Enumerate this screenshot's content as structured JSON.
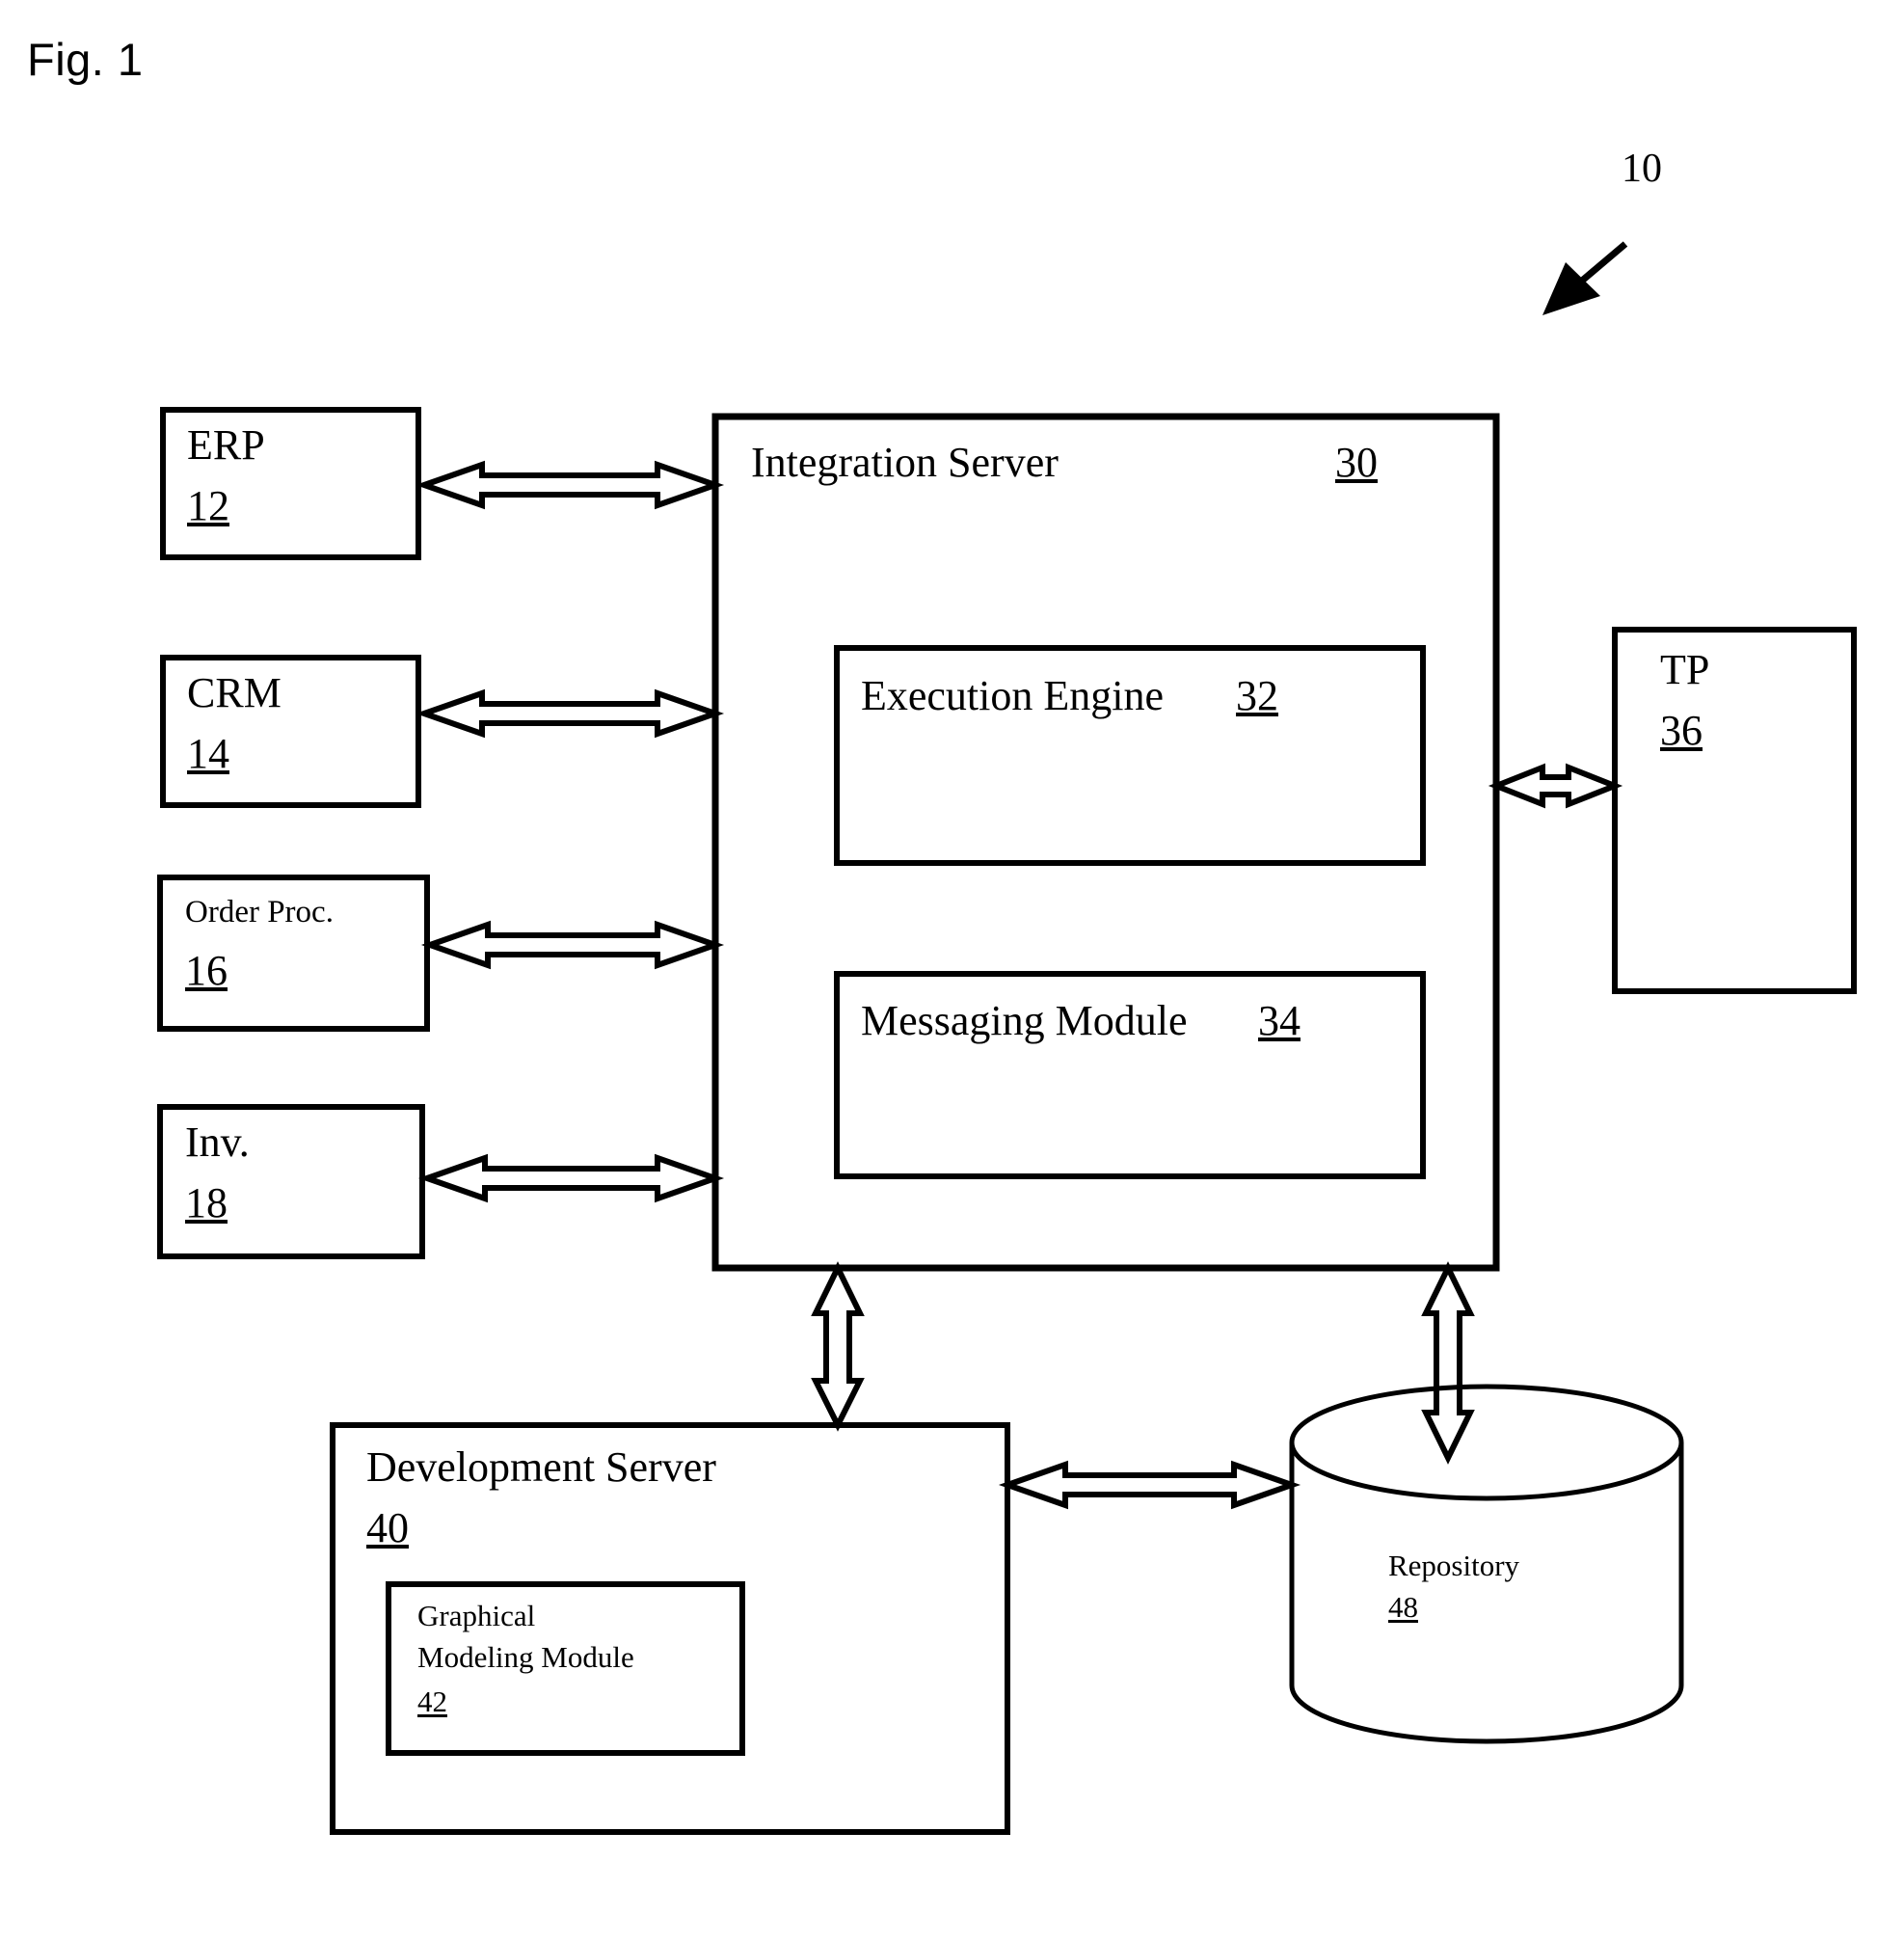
{
  "figure": {
    "label": "Fig. 1",
    "system_ref": "10"
  },
  "nodes": {
    "erp": {
      "title": "ERP",
      "ref": "12"
    },
    "crm": {
      "title": "CRM",
      "ref": "14"
    },
    "order_proc": {
      "title": "Order Proc.",
      "ref": "16"
    },
    "inv": {
      "title": "Inv.",
      "ref": "18"
    },
    "integration_server": {
      "title": "Integration Server",
      "ref": "30"
    },
    "execution_engine": {
      "title": "Execution Engine",
      "ref": "32"
    },
    "messaging_module": {
      "title": "Messaging Module",
      "ref": "34"
    },
    "tp": {
      "title": "TP",
      "ref": "36"
    },
    "development_server": {
      "title": "Development Server",
      "ref": "40"
    },
    "graphical_modeling_module": {
      "title_line1": "Graphical",
      "title_line2": "Modeling Module",
      "ref": "42"
    },
    "repository": {
      "title": "Repository",
      "ref": "48"
    }
  },
  "connectors": [
    {
      "name": "erp-to-integration-server",
      "type": "double-arrow-horizontal"
    },
    {
      "name": "crm-to-integration-server",
      "type": "double-arrow-horizontal"
    },
    {
      "name": "order-proc-to-integration-server",
      "type": "double-arrow-horizontal"
    },
    {
      "name": "inv-to-integration-server",
      "type": "double-arrow-horizontal"
    },
    {
      "name": "integration-server-to-tp",
      "type": "double-arrow-horizontal"
    },
    {
      "name": "integration-server-to-development-server",
      "type": "double-arrow-vertical"
    },
    {
      "name": "integration-server-to-repository",
      "type": "double-arrow-vertical"
    },
    {
      "name": "development-server-to-repository",
      "type": "double-arrow-horizontal"
    },
    {
      "name": "system-pointer",
      "type": "solid-arrow"
    }
  ],
  "style": {
    "ink": "#000000",
    "paper": "#ffffff"
  }
}
